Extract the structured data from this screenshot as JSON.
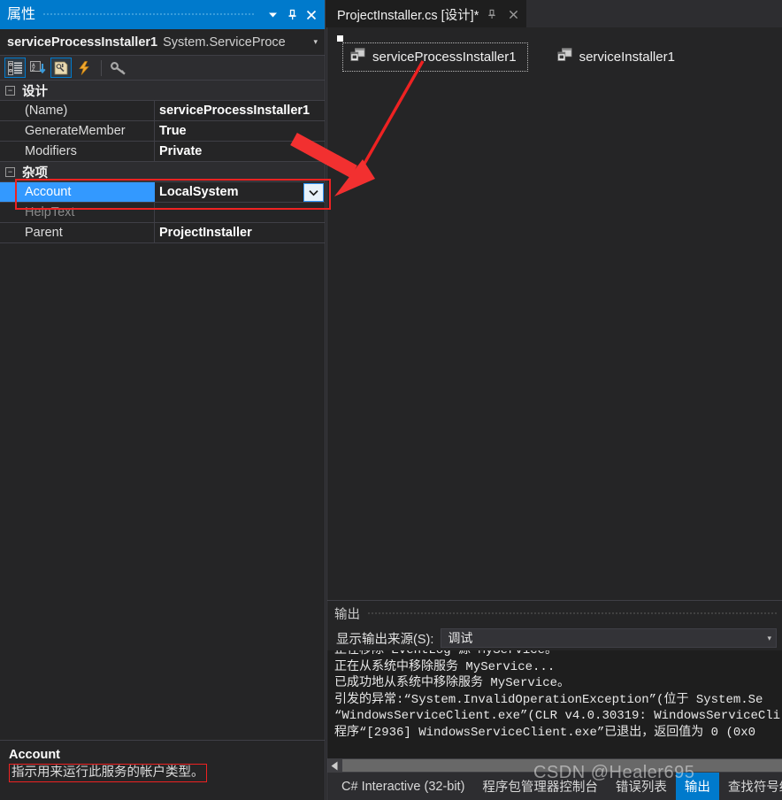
{
  "properties_panel": {
    "title": "属性",
    "titlebar_buttons": [
      {
        "name": "dropdown-menu-icon",
        "glyph": "▼"
      },
      {
        "name": "pin-icon",
        "glyph": "pin"
      },
      {
        "name": "close-icon",
        "glyph": "✕"
      }
    ],
    "object_name": "serviceProcessInstaller1",
    "object_type": "System.ServiceProce",
    "object_caret": "▾",
    "toolbar": [
      {
        "name": "categorized-view-icon",
        "active": true
      },
      {
        "name": "alphabetical-sort-icon",
        "active": false
      },
      {
        "name": "properties-page-icon",
        "active": true
      },
      {
        "name": "events-icon",
        "active": false
      },
      {
        "name": "property-pages-icon",
        "active": false
      }
    ],
    "categories": [
      {
        "name": "设计",
        "expander": "−",
        "rows": [
          {
            "name": "(Name)",
            "value": "serviceProcessInstaller1",
            "selected": false,
            "dim": false,
            "combo": false
          },
          {
            "name": "GenerateMember",
            "value": "True",
            "selected": false,
            "dim": false,
            "combo": false
          },
          {
            "name": "Modifiers",
            "value": "Private",
            "selected": false,
            "dim": false,
            "combo": false
          }
        ]
      },
      {
        "name": "杂项",
        "expander": "−",
        "rows": [
          {
            "name": "Account",
            "value": "LocalSystem",
            "selected": true,
            "dim": false,
            "combo": true
          },
          {
            "name": "HelpText",
            "value": "",
            "selected": false,
            "dim": true,
            "combo": false
          },
          {
            "name": "Parent",
            "value": "ProjectInstaller",
            "selected": false,
            "dim": false,
            "combo": false
          }
        ]
      }
    ],
    "description": {
      "title": "Account",
      "text": "指示用来运行此服务的帐户类型。"
    }
  },
  "editor": {
    "tab": {
      "label": "ProjectInstaller.cs [设计]*",
      "pin_glyph": "pin",
      "close_glyph": "✕"
    },
    "components": [
      {
        "label": "serviceProcessInstaller1",
        "icon": "component-icon",
        "selected": true
      },
      {
        "label": "serviceInstaller1",
        "icon": "component-icon",
        "selected": false
      }
    ]
  },
  "output": {
    "title": "输出",
    "source_label": "显示输出来源(S):",
    "source_value": "调试",
    "source_caret": "▾",
    "lines": [
      "正在移除 EventLog 源 MyService。",
      "正在从系统中移除服务 MyService...",
      "已成功地从系统中移除服务 MyService。",
      "引发的异常:“System.InvalidOperationException”(位于 System.Se",
      "“WindowsServiceClient.exe”(CLR v4.0.30319: WindowsServiceCli",
      "程序“[2936] WindowsServiceClient.exe”已退出，返回值为 0 (0x0"
    ],
    "scroll_left_glyph": "◀"
  },
  "bottom_tabs": [
    {
      "label": "C# Interactive (32-bit)",
      "selected": false
    },
    {
      "label": "程序包管理器控制台",
      "selected": false
    },
    {
      "label": "错误列表",
      "selected": false
    },
    {
      "label": "输出",
      "selected": true
    },
    {
      "label": "查找符号结果",
      "selected": false
    }
  ],
  "watermark": {
    "text": "CSDN @Healer695"
  },
  "colors": {
    "accent": "#007acc",
    "selection": "#3399ff",
    "annotation": "#ee2222",
    "panel_bg": "#252526",
    "editor_bg": "#1e1e1e"
  }
}
